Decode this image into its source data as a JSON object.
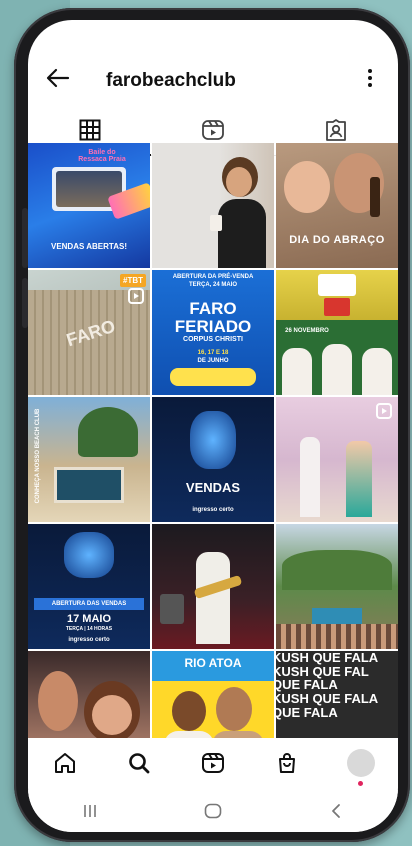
{
  "header": {
    "username": "farobeachclub"
  },
  "tabs": [
    {
      "name": "posts-grid",
      "icon": "grid-icon",
      "active": true
    },
    {
      "name": "reels",
      "icon": "reels-icon",
      "active": false
    },
    {
      "name": "tagged",
      "icon": "tagged-icon",
      "active": false
    }
  ],
  "grid": {
    "tile1": {
      "title": "Baile do Ressaca Praia",
      "sub": "VENDAS ABERTAS!"
    },
    "tile3": {
      "caption": "DIA DO ABRAÇO"
    },
    "tile4": {
      "sign": "FARO",
      "badge": "#TBT"
    },
    "tile5": {
      "top": "ABERTURA DA PRÉ-VENDA",
      "sub1": "TERÇA, 24 MAIO",
      "title1": "FARO",
      "title2": "FERIADO",
      "sub2": "CORPUS CHRISTI",
      "dates": "16, 17 E 18",
      "month": "DE JUNHO"
    },
    "tile6": {
      "date": "26 NOVEMBRO"
    },
    "tile7": {
      "vertical": "CONHEÇA NOSSO BEACH CLUB"
    },
    "tile8": {
      "label": "VENDAS",
      "ticket": "ingresso certo"
    },
    "tile10": {
      "date": "17 MAIO",
      "sub": "TERÇA | 14 HORAS",
      "bar": "ABERTURA DAS VENDAS",
      "ticket": "ingresso certo"
    },
    "tile14": {
      "title": "RIO ATOA"
    },
    "tile15": {
      "lines": [
        "KUSH QUE FALA",
        "KUSH QUE FAL",
        "QUE FALA",
        "KUSH QUE FALA",
        "QUE FALA"
      ]
    }
  },
  "colors": {
    "accent": "#e0245e",
    "text": "#111111"
  }
}
